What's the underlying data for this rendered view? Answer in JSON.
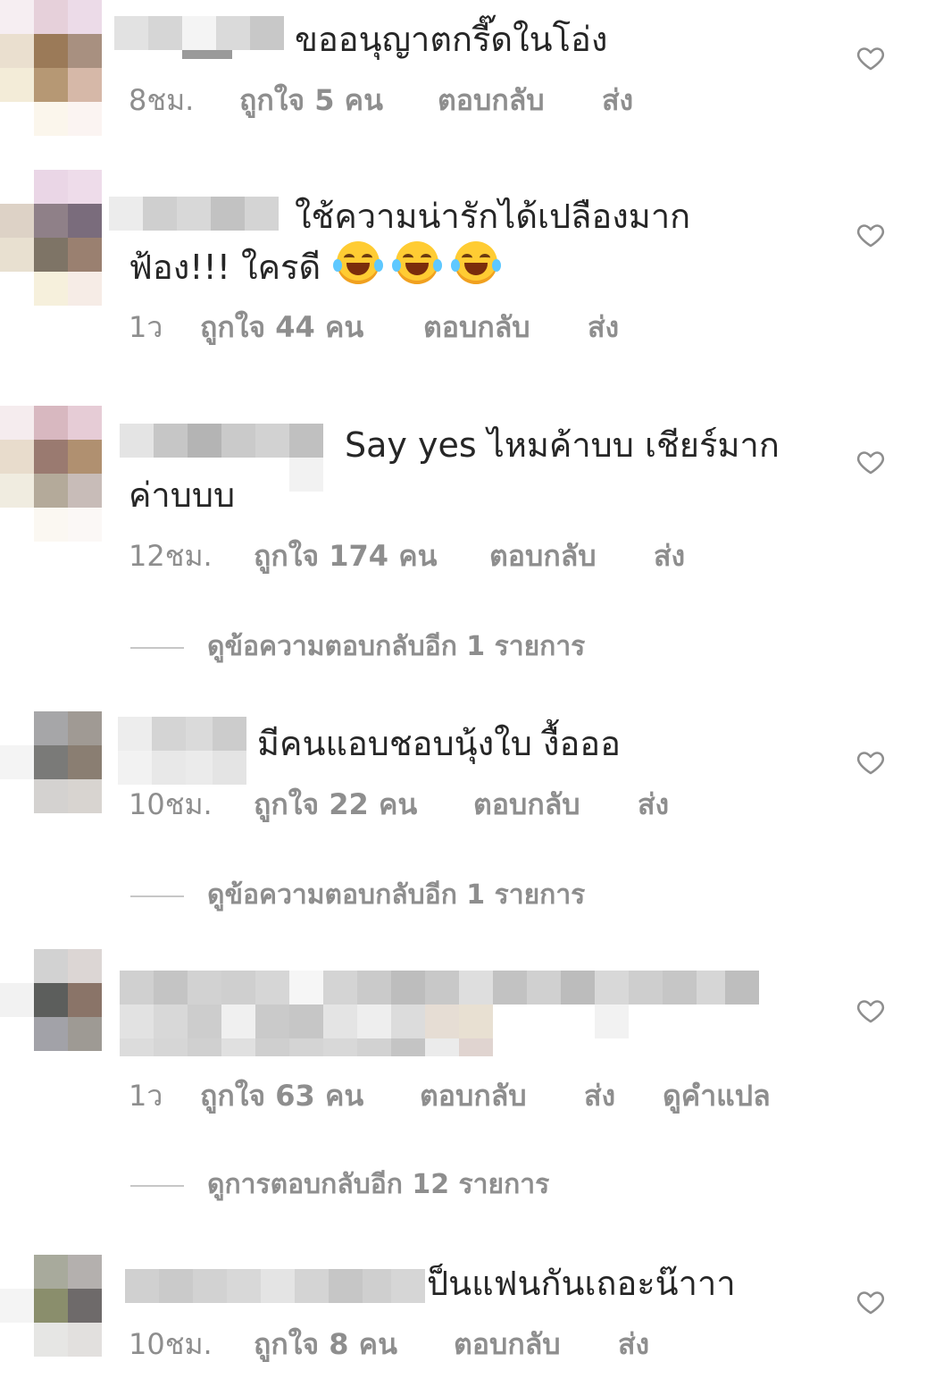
{
  "comments": [
    {
      "text": "ขออนุญาตกรี๊ดในโอ่ง",
      "time": "8ชม.",
      "likes": "ถูกใจ 5 คน",
      "reply": "ตอบกลับ",
      "send": "ส่ง"
    },
    {
      "text_line1": "ใช้ความน่ารักได้เปลืองมาก",
      "text_line2": "ฟ้อง!!! ใครดี",
      "emoji": "face-with-tears-of-joy",
      "time": "1ว",
      "likes": "ถูกใจ 44 คน",
      "reply": "ตอบกลับ",
      "send": "ส่ง"
    },
    {
      "text_line1": "Say yes ไหมค้าบบ เชียร์มาก",
      "text_line2": "ค่าบบบ",
      "time": "12ชม.",
      "likes": "ถูกใจ 174 คน",
      "reply": "ตอบกลับ",
      "send": "ส่ง",
      "view_replies": "ดูข้อความตอบกลับอีก 1 รายการ"
    },
    {
      "text": "มีคนแอบชอบนุ้งใบ งื้อออ",
      "time": "10ชม.",
      "likes": "ถูกใจ 22 คน",
      "reply": "ตอบกลับ",
      "send": "ส่ง",
      "view_replies": "ดูข้อความตอบกลับอีก 1 รายการ"
    },
    {
      "text": "",
      "time": "1ว",
      "likes": "ถูกใจ 63 คน",
      "reply": "ตอบกลับ",
      "send": "ส่ง",
      "translate": "ดูคำแปล",
      "view_replies": "ดูการตอบกลับอีก 12 รายการ"
    },
    {
      "text": "ป็นแฟนกันเถอะน๊าาา",
      "time": "10ชม.",
      "likes": "ถูกใจ 8 คน",
      "reply": "ตอบกลับ",
      "send": "ส่ง"
    }
  ],
  "icons": {
    "like": "heart-outline-icon"
  },
  "colors": {
    "text": "#262626",
    "meta": "#8e8e8e",
    "divider": "#c7c7c7"
  }
}
